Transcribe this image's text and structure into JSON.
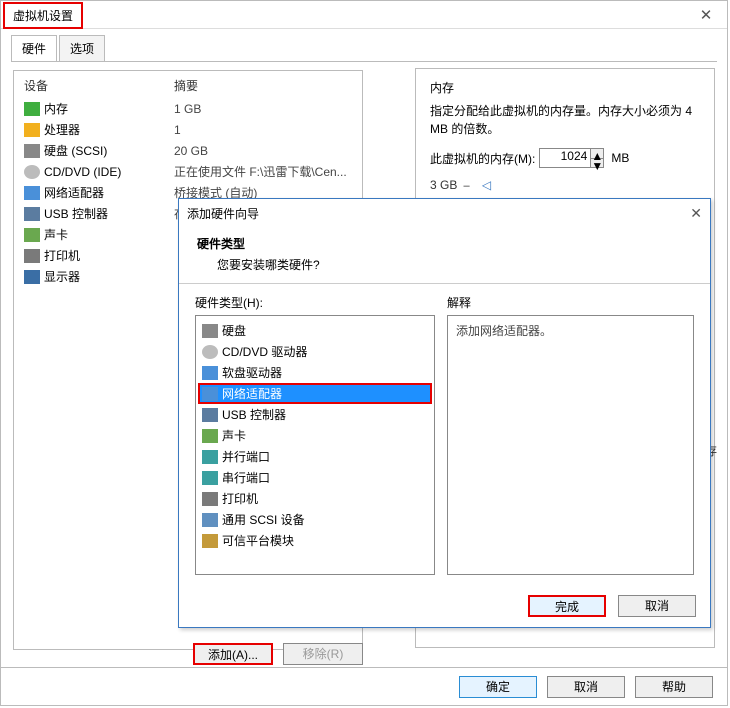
{
  "outer": {
    "title": "虚拟机设置",
    "tabs": {
      "hardware": "硬件",
      "options": "选项"
    },
    "columns": {
      "device": "设备",
      "summary": "摘要"
    },
    "hw": [
      {
        "icon": "i-mem",
        "name": "内存",
        "summary": "1 GB"
      },
      {
        "icon": "i-cpu",
        "name": "处理器",
        "summary": "1"
      },
      {
        "icon": "i-disk",
        "name": "硬盘 (SCSI)",
        "summary": "20 GB"
      },
      {
        "icon": "i-cd",
        "name": "CD/DVD (IDE)",
        "summary": "正在使用文件 F:\\迅雷下载\\Cen..."
      },
      {
        "icon": "i-net",
        "name": "网络适配器",
        "summary": "桥接模式 (自动)"
      },
      {
        "icon": "i-usb",
        "name": "USB 控制器",
        "summary": "存在"
      },
      {
        "icon": "i-snd",
        "name": "声卡",
        "summary": ""
      },
      {
        "icon": "i-prn",
        "name": "打印机",
        "summary": ""
      },
      {
        "icon": "i-disp",
        "name": "显示器",
        "summary": ""
      }
    ],
    "mem": {
      "heading": "内存",
      "desc": "指定分配给此虚拟机的内存量。内存大小必须为 4 MB 的倍数。",
      "label": "此虚拟机的内存(M):",
      "value": "1024",
      "unit": "MB",
      "tick": "3 GB",
      "sidenote": "内存"
    },
    "add": "添加(A)...",
    "remove": "移除(R)",
    "ok": "确定",
    "cancel": "取消",
    "help": "帮助"
  },
  "wizard": {
    "title": "添加硬件向导",
    "h1": "硬件类型",
    "h2": "您要安装哪类硬件?",
    "listlabel": "硬件类型(H):",
    "desclabel": "解释",
    "desctext": "添加网络适配器。",
    "items": [
      {
        "icon": "i-disk",
        "label": "硬盘"
      },
      {
        "icon": "i-cd",
        "label": "CD/DVD 驱动器"
      },
      {
        "icon": "i-floppy",
        "label": "软盘驱动器"
      },
      {
        "icon": "i-net",
        "label": "网络适配器",
        "selected": true
      },
      {
        "icon": "i-usb",
        "label": "USB 控制器"
      },
      {
        "icon": "i-snd",
        "label": "声卡"
      },
      {
        "icon": "i-par",
        "label": "并行端口"
      },
      {
        "icon": "i-ser",
        "label": "串行端口"
      },
      {
        "icon": "i-prn",
        "label": "打印机"
      },
      {
        "icon": "i-scsi",
        "label": "通用 SCSI 设备"
      },
      {
        "icon": "i-tpm",
        "label": "可信平台模块"
      }
    ],
    "finish": "完成",
    "cancel": "取消"
  }
}
